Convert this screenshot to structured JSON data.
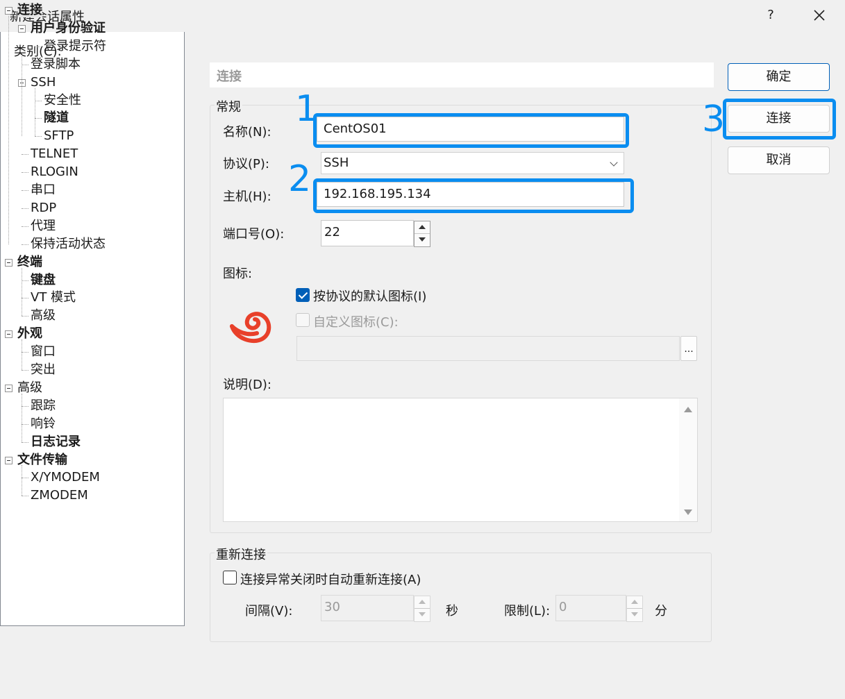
{
  "window": {
    "title": "新建会话属性",
    "help": "?"
  },
  "category_label": "类别(C):",
  "tree": [
    {
      "label": "连接",
      "bold": true,
      "selected": true
    },
    {
      "label": "用户身份验证",
      "bold": true
    },
    {
      "label": "登录提示符",
      "bold": false
    },
    {
      "label": "登录脚本",
      "bold": false
    },
    {
      "label": "SSH",
      "bold": false
    },
    {
      "label": "安全性",
      "bold": false
    },
    {
      "label": "隧道",
      "bold": true
    },
    {
      "label": "SFTP",
      "bold": false
    },
    {
      "label": "TELNET",
      "bold": false
    },
    {
      "label": "RLOGIN",
      "bold": false
    },
    {
      "label": "串口",
      "bold": false
    },
    {
      "label": "RDP",
      "bold": false
    },
    {
      "label": "代理",
      "bold": false
    },
    {
      "label": "保持活动状态",
      "bold": false
    },
    {
      "label": "终端",
      "bold": true
    },
    {
      "label": "键盘",
      "bold": true
    },
    {
      "label": "VT 模式",
      "bold": false
    },
    {
      "label": "高级",
      "bold": false
    },
    {
      "label": "外观",
      "bold": true
    },
    {
      "label": "窗口",
      "bold": false
    },
    {
      "label": "突出",
      "bold": false
    },
    {
      "label": "高级",
      "bold": false
    },
    {
      "label": "跟踪",
      "bold": false
    },
    {
      "label": "响铃",
      "bold": false
    },
    {
      "label": "日志记录",
      "bold": true
    },
    {
      "label": "文件传输",
      "bold": true
    },
    {
      "label": "X/YMODEM",
      "bold": false
    },
    {
      "label": "ZMODEM",
      "bold": false
    }
  ],
  "panel": {
    "header": "连接",
    "general": {
      "title": "常规",
      "name_label": "名称(N):",
      "name_value": "CentOS01",
      "protocol_label": "协议(P):",
      "protocol_value": "SSH",
      "host_label": "主机(H):",
      "host_value": "192.168.195.134",
      "port_label": "端口号(O):",
      "port_value": "22",
      "icon_label": "图标:",
      "default_icon_label": "按协议的默认图标(I)",
      "custom_icon_label": "自定义图标(C):",
      "browse_label": "...",
      "desc_label": "说明(D):"
    },
    "reconnect": {
      "title": "重新连接",
      "auto_label": "连接异常关闭时自动重新连接(A)",
      "interval_label": "间隔(V):",
      "interval_value": "30",
      "interval_unit": "秒",
      "limit_label": "限制(L):",
      "limit_value": "0",
      "limit_unit": "分"
    }
  },
  "buttons": {
    "ok": "确定",
    "connect": "连接",
    "cancel": "取消"
  },
  "annotations": {
    "a1": "1",
    "a2": "2",
    "a3": "3"
  },
  "colors": {
    "accent": "#0a8df0",
    "checkbox": "#005fb8",
    "logo": "#e8402a"
  }
}
